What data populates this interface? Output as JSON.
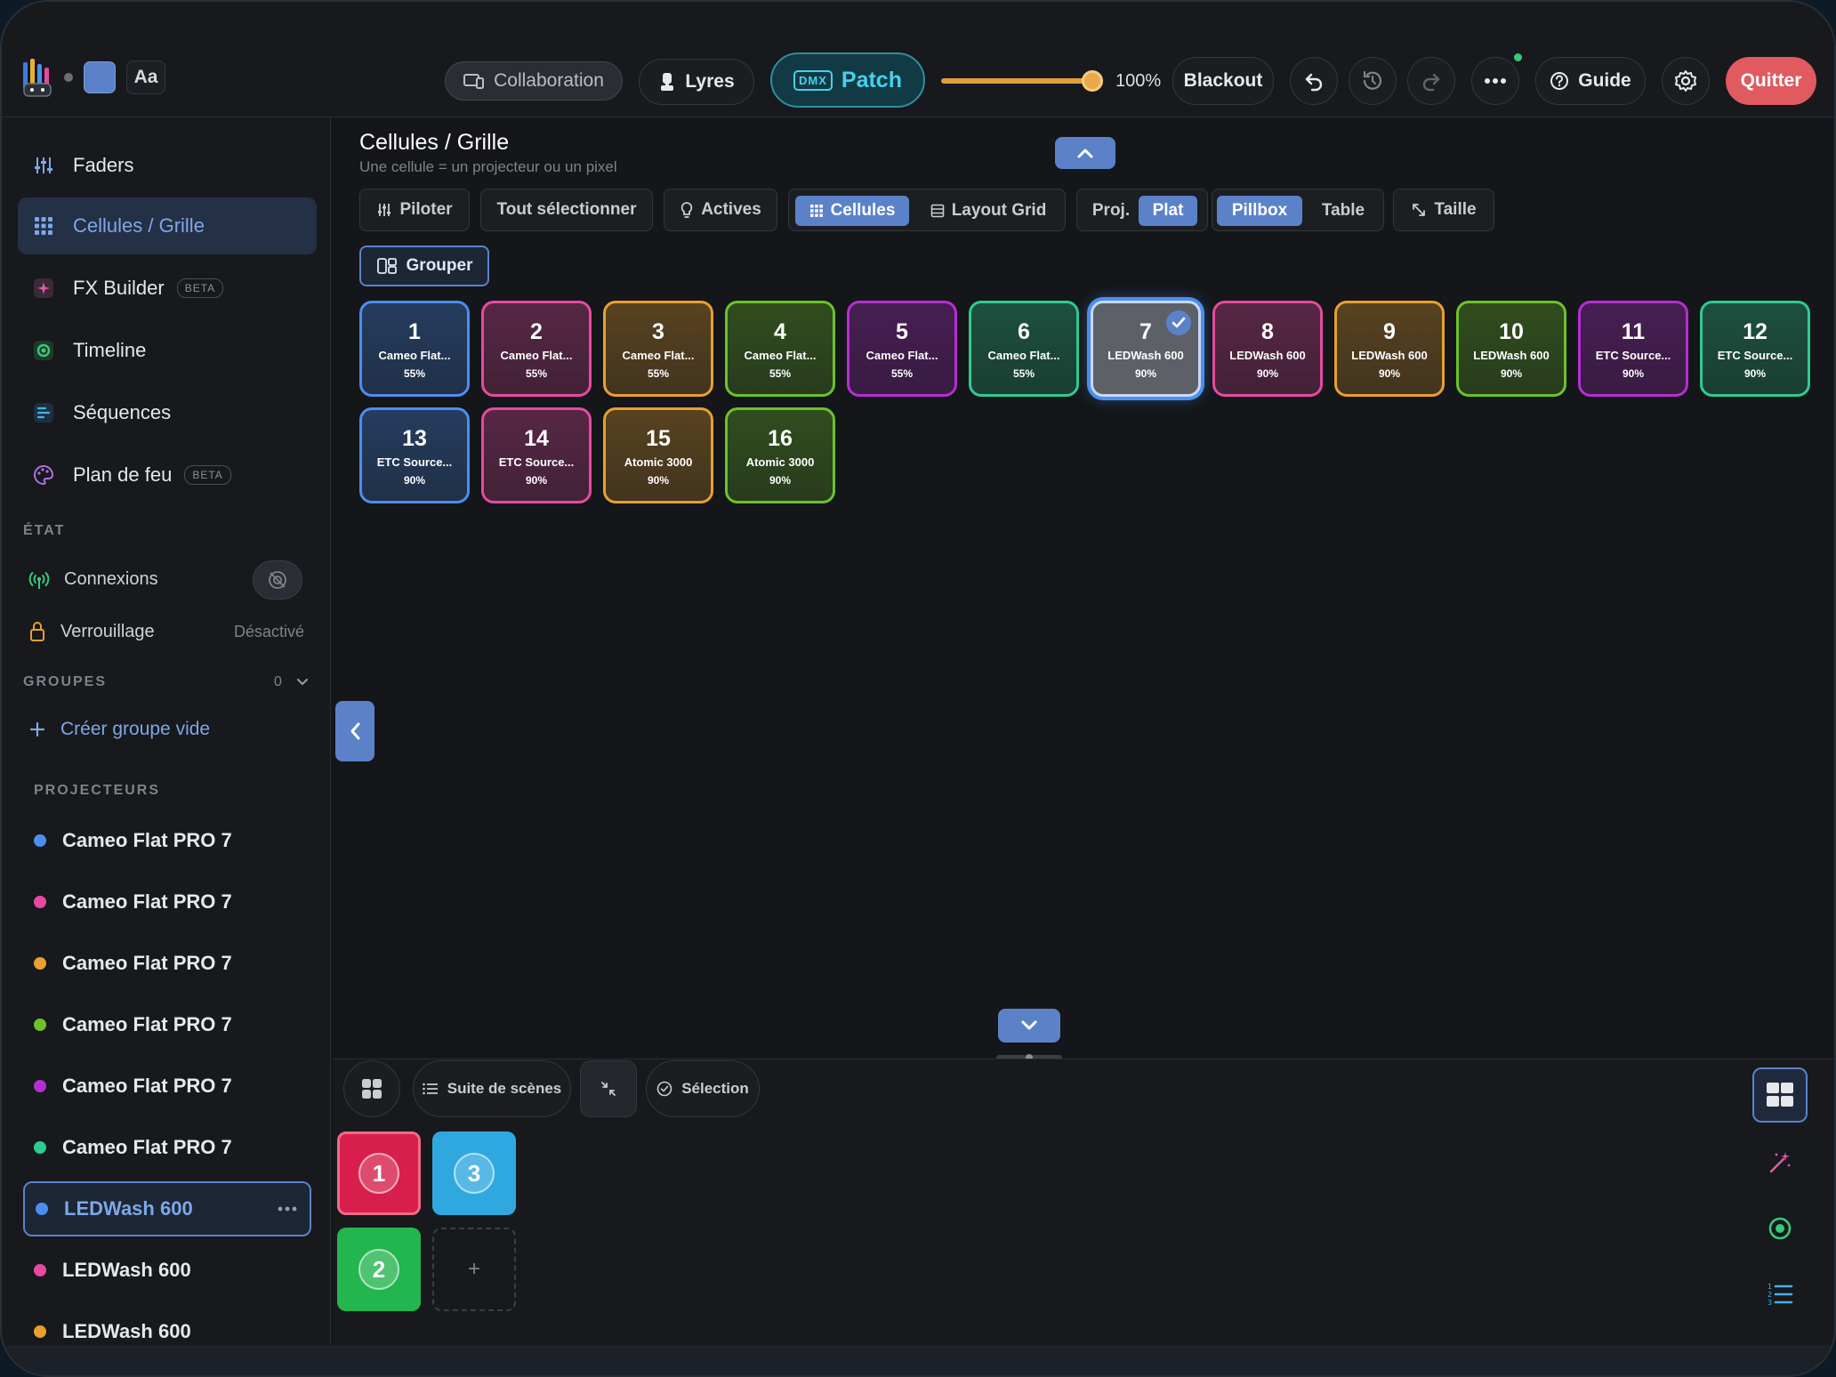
{
  "topbar": {
    "collaboration": "Collaboration",
    "lyres": "Lyres",
    "dmx_badge": "DMX",
    "patch": "Patch",
    "master_level": "100%",
    "master_fraction": 1.0,
    "blackout": "Blackout",
    "guide": "Guide",
    "quit": "Quitter",
    "font_button": "Aa"
  },
  "sidebar": {
    "nav": [
      {
        "label": "Faders",
        "icon": "sliders-icon"
      },
      {
        "label": "Cellules / Grille",
        "icon": "grid-icon",
        "active": true
      },
      {
        "label": "FX Builder",
        "icon": "sparkle-icon",
        "badge": "BETA"
      },
      {
        "label": "Timeline",
        "icon": "timeline-icon"
      },
      {
        "label": "Séquences",
        "icon": "sequence-icon"
      },
      {
        "label": "Plan de feu",
        "icon": "palette-icon",
        "badge": "BETA"
      }
    ],
    "state_header": "ÉTAT",
    "connections": "Connexions",
    "lock": "Verrouillage",
    "lock_value": "Désactivé",
    "groups_header": "GROUPES",
    "groups_count": "0",
    "create_group": "Créer groupe vide",
    "projectors_header": "PROJECTEURS",
    "projectors": [
      {
        "name": "Cameo Flat PRO 7",
        "color": "#4a8ef0"
      },
      {
        "name": "Cameo Flat PRO 7",
        "color": "#e54aa0"
      },
      {
        "name": "Cameo Flat PRO 7",
        "color": "#e8a030"
      },
      {
        "name": "Cameo Flat PRO 7",
        "color": "#6cc22a"
      },
      {
        "name": "Cameo Flat PRO 7",
        "color": "#b52fd0"
      },
      {
        "name": "Cameo Flat PRO 7",
        "color": "#2fcb8f"
      },
      {
        "name": "LEDWash 600",
        "color": "#4a8ef0",
        "selected": true
      },
      {
        "name": "LEDWash 600",
        "color": "#e54aa0"
      },
      {
        "name": "LEDWash 600",
        "color": "#e8a030"
      }
    ]
  },
  "main": {
    "title": "Cellules / Grille",
    "subtitle": "Une cellule = un projecteur ou un pixel",
    "toolbar": {
      "pilot": "Piloter",
      "select_all": "Tout sélectionner",
      "active": "Actives",
      "cells": "Cellules",
      "layout_grid": "Layout Grid",
      "proj": "Proj.",
      "flat": "Plat",
      "pillbox": "Pillbox",
      "table": "Table",
      "size": "Taille"
    },
    "group_button": "Grouper",
    "cells": [
      {
        "n": "1",
        "model": "Cameo Flat...",
        "level": "55%",
        "color": "#4a8ef0"
      },
      {
        "n": "2",
        "model": "Cameo Flat...",
        "level": "55%",
        "color": "#e54aa0"
      },
      {
        "n": "3",
        "model": "Cameo Flat...",
        "level": "55%",
        "color": "#e8a030"
      },
      {
        "n": "4",
        "model": "Cameo Flat...",
        "level": "55%",
        "color": "#6cc22a"
      },
      {
        "n": "5",
        "model": "Cameo Flat...",
        "level": "55%",
        "color": "#b52fd0"
      },
      {
        "n": "6",
        "model": "Cameo Flat...",
        "level": "55%",
        "color": "#2fcb8f"
      },
      {
        "n": "7",
        "model": "LEDWash 600",
        "level": "90%",
        "color": "#4a8ef0",
        "selected": true
      },
      {
        "n": "8",
        "model": "LEDWash 600",
        "level": "90%",
        "color": "#e54aa0"
      },
      {
        "n": "9",
        "model": "LEDWash 600",
        "level": "90%",
        "color": "#e8a030"
      },
      {
        "n": "10",
        "model": "LEDWash 600",
        "level": "90%",
        "color": "#6cc22a"
      },
      {
        "n": "11",
        "model": "ETC Source...",
        "level": "90%",
        "color": "#b52fd0"
      },
      {
        "n": "12",
        "model": "ETC Source...",
        "level": "90%",
        "color": "#2fcb8f"
      },
      {
        "n": "13",
        "model": "ETC Source...",
        "level": "90%",
        "color": "#4a8ef0"
      },
      {
        "n": "14",
        "model": "ETC Source...",
        "level": "90%",
        "color": "#e54aa0"
      },
      {
        "n": "15",
        "model": "Atomic 3000",
        "level": "90%",
        "color": "#e8a030"
      },
      {
        "n": "16",
        "model": "Atomic 3000",
        "level": "90%",
        "color": "#6cc22a"
      }
    ]
  },
  "bottom": {
    "scene_suite": "Suite de scènes",
    "selection": "Sélection",
    "scenes": [
      {
        "label": "1",
        "color": "#d81f4b"
      },
      {
        "label": "3",
        "color": "#2fa8e0"
      },
      {
        "label": "2",
        "color": "#23b54e"
      }
    ],
    "add": "+"
  }
}
